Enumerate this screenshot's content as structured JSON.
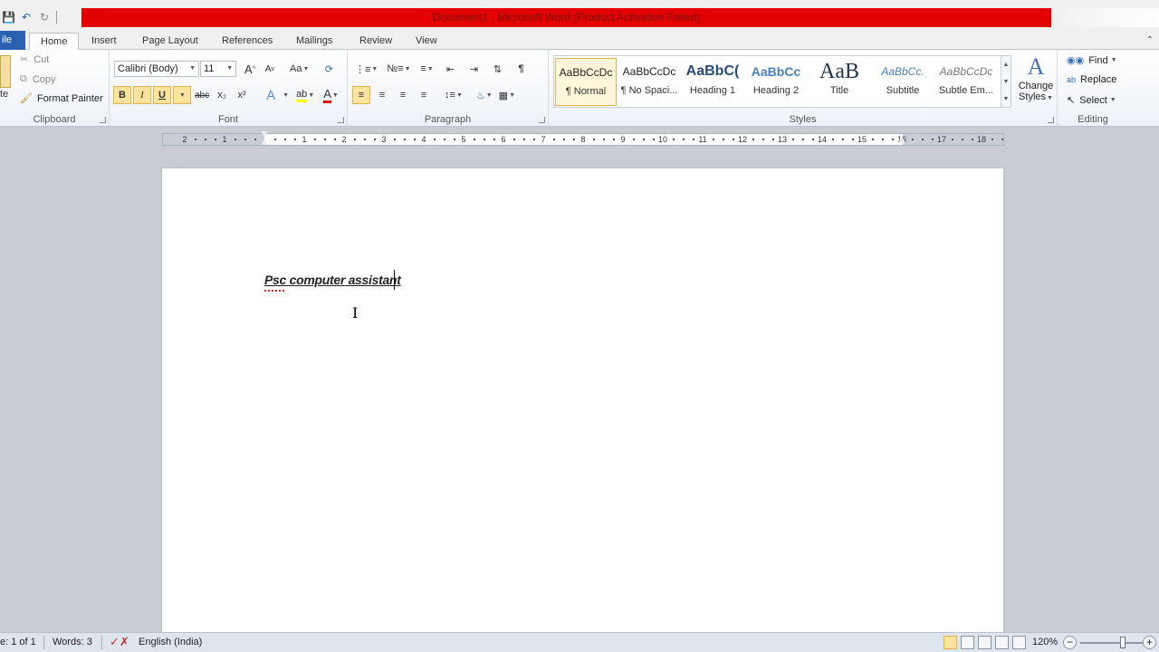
{
  "window": {
    "title": "Document1  -  Microsoft Word (Product Activation Failed)"
  },
  "tabs": {
    "file": "ile",
    "home": "Home",
    "insert": "Insert",
    "page_layout": "Page Layout",
    "references": "References",
    "mailings": "Mailings",
    "review": "Review",
    "view": "View"
  },
  "clipboard": {
    "cut": "Cut",
    "copy": "Copy",
    "format_painter": "Format Painter",
    "paste": "te",
    "label": "Clipboard"
  },
  "font": {
    "name": "Calibri (Body)",
    "size": "11",
    "grow": "A",
    "shrink": "A",
    "change_case": "Aa",
    "bold": "B",
    "italic": "I",
    "underline": "U",
    "strikethrough": "abc",
    "subscript": "x₂",
    "superscript": "x²",
    "font_color": "A",
    "label": "Font"
  },
  "paragraph": {
    "pilcrow": "¶",
    "label": "Paragraph"
  },
  "styles": {
    "items": [
      {
        "preview": "AaBbCcDc",
        "name": "¶ Normal"
      },
      {
        "preview": "AaBbCcDc",
        "name": "¶ No Spaci..."
      },
      {
        "preview": "AaBbC(",
        "name": "Heading 1"
      },
      {
        "preview": "AaBbCc",
        "name": "Heading 2"
      },
      {
        "preview": "AaB",
        "name": "Title"
      },
      {
        "preview": "AaBbCc.",
        "name": "Subtitle"
      },
      {
        "preview": "AaBbCcDc",
        "name": "Subtle Em..."
      }
    ],
    "change_styles_1": "Change",
    "change_styles_2": "Styles",
    "label": "Styles"
  },
  "editing": {
    "find": "Find",
    "replace": "Replace",
    "select": "Select",
    "label": "Editing"
  },
  "ruler": {
    "left_numbers": [
      "2",
      "1"
    ],
    "right_numbers": [
      "1",
      "2",
      "3",
      "4",
      "5",
      "6",
      "7",
      "8",
      "9",
      "10",
      "11",
      "12",
      "13",
      "14",
      "15",
      "16",
      "17",
      "18"
    ]
  },
  "document": {
    "text": "Psc computer assistant"
  },
  "status": {
    "page": "e: 1 of 1",
    "words": "Words: 3",
    "language": "English (India)",
    "zoom": "120%",
    "zoom_minus": "−",
    "zoom_plus": "+"
  },
  "colors": {
    "title_strip": "#e30000",
    "file_tab": "#2b5fb1",
    "highlight": "#fde39c"
  }
}
